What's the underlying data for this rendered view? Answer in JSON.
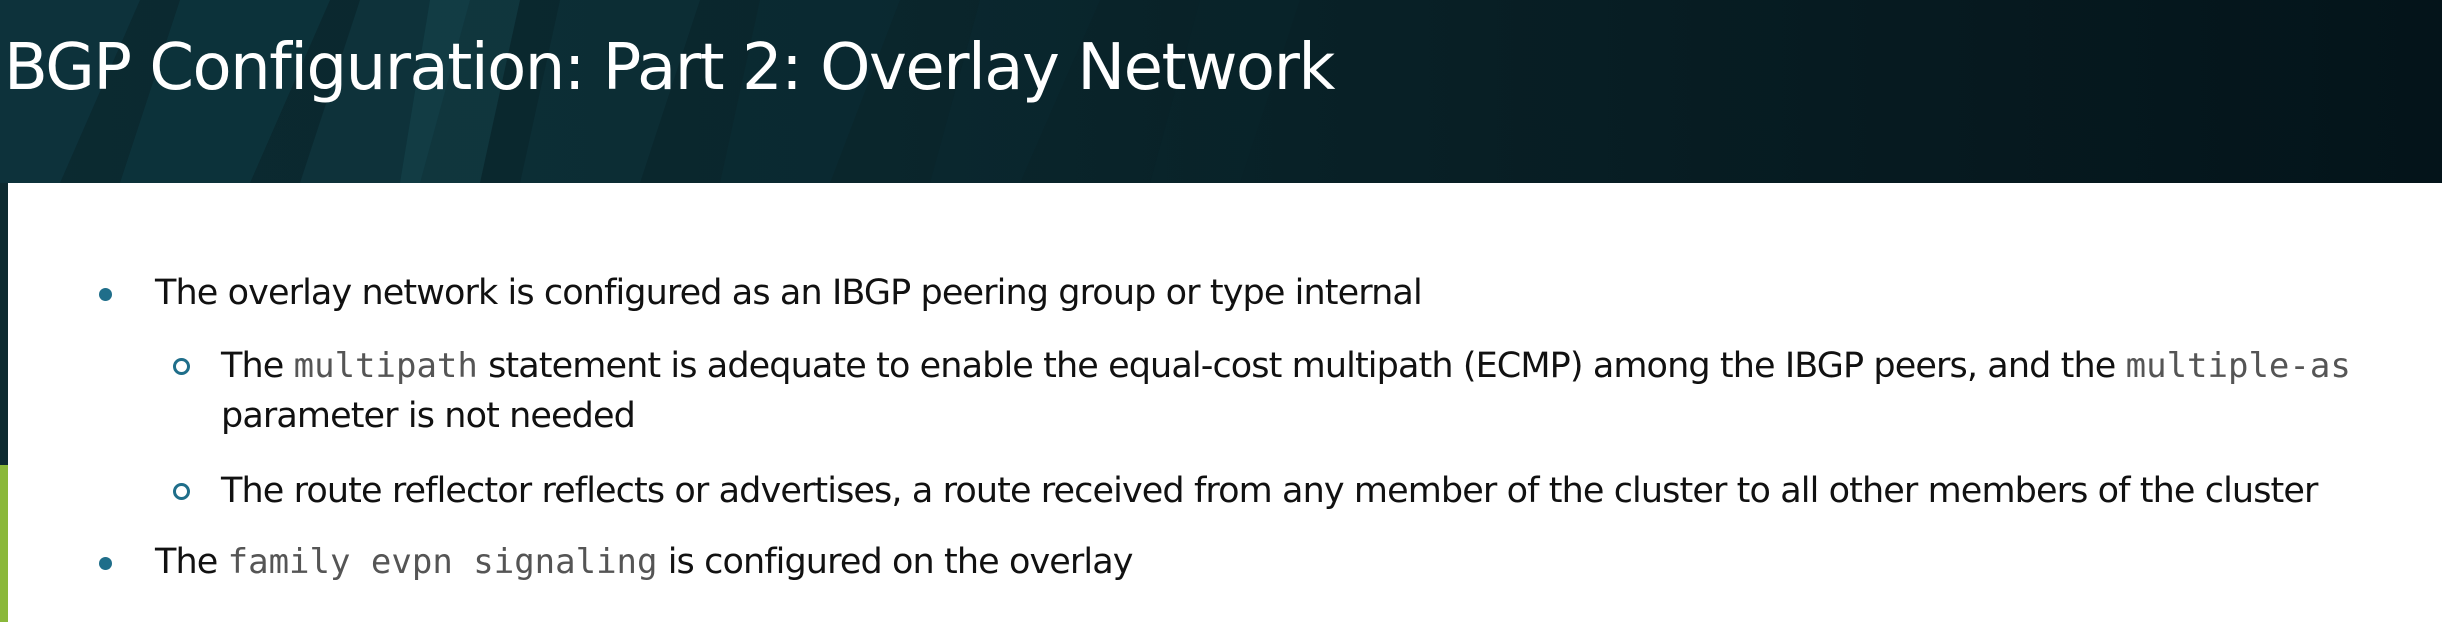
{
  "title": "BGP Configuration: Part 2: Overlay Network",
  "bullets": [
    {
      "text": "The overlay network is configured as an IBGP peering group or type internal"
    },
    {
      "pre": "The ",
      "code1": "multipath",
      "mid": " statement is adequate to enable the equal-cost multipath (ECMP) among the IBGP peers, and the ",
      "code2": "multiple-as",
      "post": "parameter is not needed"
    },
    {
      "text": "The route reflector reflects or advertises, a route received from any member of the cluster to all other members of the cluster"
    },
    {
      "pre": "The ",
      "code": "family evpn signaling",
      "post": " is configured on the overlay"
    }
  ],
  "colors": {
    "title_bg": "#06181d",
    "title_text": "#ffffff",
    "bullet": "#1f6e8a",
    "accent_green": "#8ab83a",
    "code_text": "#555555"
  }
}
